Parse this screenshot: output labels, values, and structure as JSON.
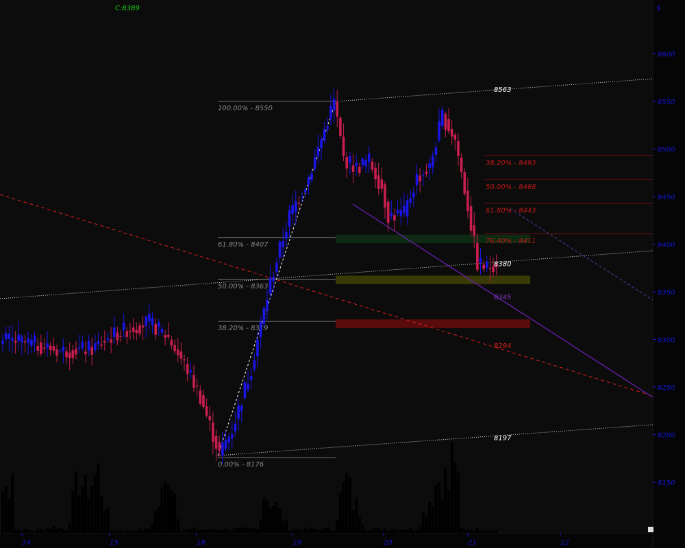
{
  "header": {
    "last_close": "C:8389",
    "axis_marker": "$"
  },
  "colors": {
    "bull": "#1a14e6",
    "bear": "#c81e50",
    "volume": "#000000",
    "grid_bg": "#0c0c0c",
    "axis_text": "#1515d0",
    "fib_retrace": "#8a8a8a",
    "fib_projection": "#c01818",
    "trend_down": "#6a1fb0",
    "trend_red_dashed": "#e02020"
  },
  "chart_data": {
    "type": "candlestick",
    "y_axis": {
      "ticks": [
        8600,
        8550,
        8500,
        8450,
        8400,
        8350,
        8300,
        8250,
        8200,
        8150
      ],
      "ylim": [
        8120,
        8650
      ],
      "position": "right"
    },
    "x_axis": {
      "ticks": [
        "14",
        "15",
        "18",
        "19",
        "20",
        "21",
        "22"
      ]
    },
    "swing_points": [
      {
        "label": "0.00% - 8176",
        "price": 8176
      },
      {
        "label": "100.00% - 8550",
        "price": 8550
      }
    ],
    "fib_retracement": [
      {
        "label": "100.00% - 8550",
        "price": 8550
      },
      {
        "label": "61.80% - 8407",
        "price": 8407
      },
      {
        "label": "50.00% - 8363",
        "price": 8363
      },
      {
        "label": "38.20% - 8319",
        "price": 8319
      },
      {
        "label": "0.00% - 8176",
        "price": 8176
      }
    ],
    "fib_projection": [
      {
        "label": "38.20% - 8493",
        "price": 8493
      },
      {
        "label": "50.00% - 8468",
        "price": 8468
      },
      {
        "label": "61.80% - 8443",
        "price": 8443
      },
      {
        "label": "76.40% - 8411",
        "price": 8411
      }
    ],
    "level_labels": [
      {
        "text": "8563",
        "price": 8563,
        "color": "#ffffff"
      },
      {
        "text": "8380",
        "price": 8380,
        "color": "#ffffff"
      },
      {
        "text": "8345",
        "price": 8345,
        "color": "#8a3ad0"
      },
      {
        "text": "8294",
        "price": 8294,
        "color": "#e02020"
      },
      {
        "text": "8197",
        "price": 8197,
        "color": "#ffffff"
      }
    ],
    "zones": [
      {
        "name": "green-zone",
        "from": 8401,
        "to": 8410,
        "color": "#0f2a12"
      },
      {
        "name": "olive-zone",
        "from": 8358,
        "to": 8367,
        "color": "#3a3a06"
      },
      {
        "name": "red-zone",
        "from": 8312,
        "to": 8321,
        "color": "#5a0c0c"
      }
    ],
    "price_anchors": [
      [
        0,
        8300
      ],
      [
        10,
        8295
      ],
      [
        18,
        8288
      ],
      [
        28,
        8290
      ],
      [
        35,
        8305
      ],
      [
        40,
        8312
      ],
      [
        46,
        8318
      ],
      [
        52,
        8302
      ],
      [
        58,
        8268
      ],
      [
        62,
        8240
      ],
      [
        66,
        8200
      ],
      [
        68,
        8180
      ],
      [
        72,
        8205
      ],
      [
        78,
        8270
      ],
      [
        84,
        8360
      ],
      [
        90,
        8430
      ],
      [
        96,
        8470
      ],
      [
        100,
        8510
      ],
      [
        104,
        8550
      ],
      [
        107,
        8490
      ],
      [
        111,
        8480
      ],
      [
        115,
        8488
      ],
      [
        119,
        8460
      ],
      [
        121,
        8430
      ],
      [
        126,
        8432
      ],
      [
        130,
        8470
      ],
      [
        134,
        8480
      ],
      [
        138,
        8535
      ],
      [
        142,
        8510
      ],
      [
        146,
        8440
      ],
      [
        149,
        8380
      ],
      [
        152,
        8375
      ],
      [
        155,
        8382
      ]
    ],
    "volume_anchors": [
      [
        0,
        55
      ],
      [
        1,
        60
      ],
      [
        2,
        70
      ],
      [
        3,
        100
      ],
      [
        4,
        5
      ],
      [
        10,
        3
      ],
      [
        16,
        8
      ],
      [
        20,
        5
      ],
      [
        24,
        75
      ],
      [
        26,
        55
      ],
      [
        30,
        80
      ],
      [
        34,
        4
      ],
      [
        40,
        3
      ],
      [
        46,
        5
      ],
      [
        51,
        60
      ],
      [
        52,
        95
      ],
      [
        53,
        75
      ],
      [
        54,
        55
      ],
      [
        56,
        3
      ],
      [
        60,
        5
      ],
      [
        66,
        4
      ],
      [
        72,
        5
      ],
      [
        80,
        5
      ],
      [
        82,
        55
      ],
      [
        84,
        45
      ],
      [
        86,
        35
      ],
      [
        90,
        5
      ],
      [
        100,
        5
      ],
      [
        104,
        5
      ],
      [
        106,
        45
      ],
      [
        108,
        70
      ],
      [
        110,
        40
      ],
      [
        112,
        30
      ],
      [
        114,
        5
      ],
      [
        120,
        5
      ],
      [
        130,
        5
      ],
      [
        136,
        65
      ],
      [
        138,
        80
      ],
      [
        140,
        60
      ],
      [
        141,
        100
      ],
      [
        142,
        110
      ],
      [
        144,
        5
      ],
      [
        150,
        5
      ],
      [
        155,
        4
      ]
    ]
  }
}
